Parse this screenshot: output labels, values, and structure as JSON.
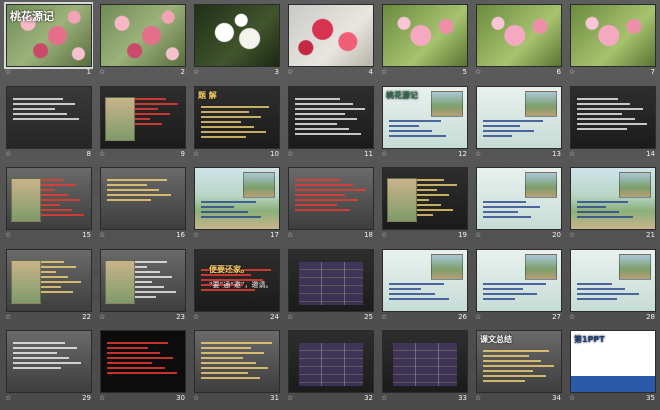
{
  "slides": [
    {
      "num": "1",
      "style": "blossom",
      "title": "桃花源记"
    },
    {
      "num": "2",
      "style": "blossom"
    },
    {
      "num": "3",
      "style": "white-b"
    },
    {
      "num": "4",
      "style": "red-b"
    },
    {
      "num": "5",
      "style": "pink-soft"
    },
    {
      "num": "6",
      "style": "pink-soft"
    },
    {
      "num": "7",
      "style": "pink-soft"
    },
    {
      "num": "8",
      "style": "darkred"
    },
    {
      "num": "9",
      "style": "darkslide"
    },
    {
      "num": "10",
      "style": "darkslide",
      "title": "题 解"
    },
    {
      "num": "11",
      "style": "darkslide"
    },
    {
      "num": "12",
      "style": "teal1",
      "title": "桃花源记"
    },
    {
      "num": "13",
      "style": "teal1"
    },
    {
      "num": "14",
      "style": "darkslide"
    },
    {
      "num": "15",
      "style": "gray1"
    },
    {
      "num": "16",
      "style": "gray1"
    },
    {
      "num": "17",
      "style": "paint1"
    },
    {
      "num": "18",
      "style": "gray1"
    },
    {
      "num": "19",
      "style": "darkslide"
    },
    {
      "num": "20",
      "style": "teal1"
    },
    {
      "num": "21",
      "style": "paint1"
    },
    {
      "num": "22",
      "style": "gray1"
    },
    {
      "num": "23",
      "style": "gray1"
    },
    {
      "num": "24",
      "style": "darkslide",
      "title": "便要还家。",
      "subtitle": "“要”通“邀”，邀请。"
    },
    {
      "num": "25",
      "style": "darkslide"
    },
    {
      "num": "26",
      "style": "teal1"
    },
    {
      "num": "27",
      "style": "teal1"
    },
    {
      "num": "28",
      "style": "teal1"
    },
    {
      "num": "29",
      "style": "gray1"
    },
    {
      "num": "30",
      "style": "blackbg"
    },
    {
      "num": "31",
      "style": "gray1"
    },
    {
      "num": "32",
      "style": "darkslide"
    },
    {
      "num": "33",
      "style": "darkslide"
    },
    {
      "num": "34",
      "style": "gray1",
      "title": "课文总结"
    },
    {
      "num": "35",
      "style": "blue-ppt",
      "title": "第1PPT"
    }
  ],
  "star_glyph": "☆"
}
